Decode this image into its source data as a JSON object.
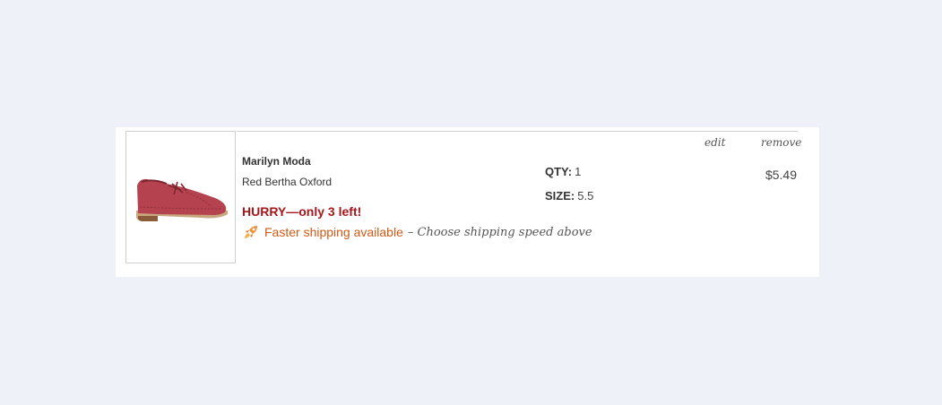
{
  "cart_item": {
    "brand": "Marilyn Moda",
    "product_name": "Red Bertha Oxford",
    "stock_warning": "HURRY—only 3 left!",
    "shipping": {
      "link_text": "Faster shipping available",
      "note": "– Choose shipping speed above",
      "icon": "rocket-icon"
    },
    "qty_label": "QTY:",
    "qty_value": "1",
    "size_label": "SIZE:",
    "size_value": "5.5",
    "edit_label": "edit",
    "remove_label": "remove",
    "price": "$5.49",
    "image_icon": "shoe-image"
  },
  "colors": {
    "background": "#eef2f8",
    "card": "#ffffff",
    "warning": "#a8161b",
    "shipping_link": "#cf5a17",
    "shoe": "#b5434f"
  }
}
